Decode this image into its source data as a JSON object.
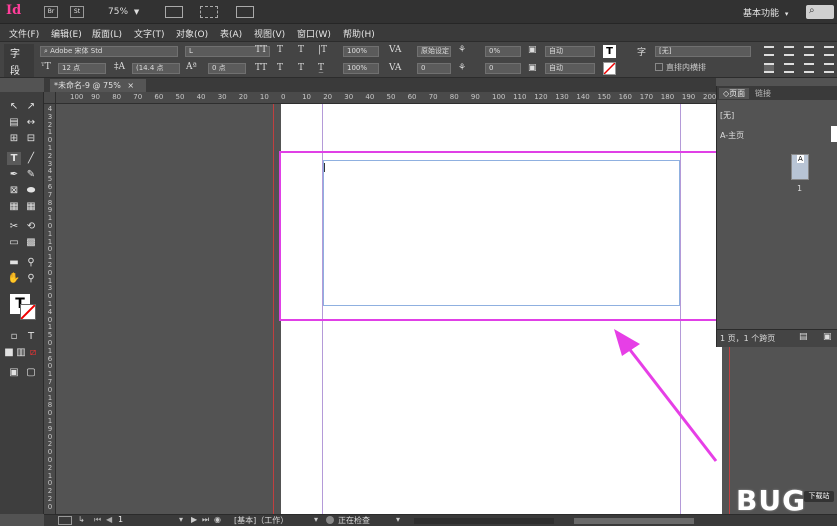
{
  "app": {
    "logo": "Id",
    "bridge_label": "Br",
    "stock_label": "St",
    "zoom": "75%",
    "workspace": "基本功能",
    "search_icon": "search-icon"
  },
  "menu": [
    "文件(F)",
    "编辑(E)",
    "版面(L)",
    "文字(T)",
    "对象(O)",
    "表(A)",
    "视图(V)",
    "窗口(W)",
    "帮助(H)"
  ],
  "control": {
    "char_mode_label": "字",
    "para_mode_label": "段",
    "font_family": "Adobe 宋体 Std",
    "font_style": "L",
    "font_size": "12 点",
    "leading": "(14.4 点",
    "baseline_shift": "0 点",
    "scale_h": "100%",
    "scale_v": "100%",
    "kerning": "原始设定",
    "tracking": "0",
    "tsume": "0%",
    "aki": "0",
    "auto1": "自动",
    "auto2": "自动",
    "char_style": "[无]",
    "tate_chu_yoko": "直排内横排",
    "tt_label": "TT",
    "t_super": "T",
    "t_label": "T"
  },
  "document": {
    "tab_title": "*未命名-9 @ 75%"
  },
  "ruler": {
    "h_ticks": [
      "100",
      "90",
      "80",
      "70",
      "60",
      "50",
      "40",
      "30",
      "20",
      "10",
      "0",
      "10",
      "20",
      "30",
      "40",
      "50",
      "60",
      "70",
      "80",
      "90",
      "100",
      "110",
      "120",
      "130",
      "140",
      "150",
      "160",
      "170",
      "180",
      "190",
      "200"
    ],
    "v_ticks": [
      "4",
      "3",
      "2",
      "1",
      "0",
      "1",
      "2",
      "3",
      "4",
      "5",
      "6",
      "7",
      "8",
      "9",
      "1",
      "0",
      "1",
      "1",
      "0",
      "1",
      "2",
      "0",
      "1",
      "3",
      "0",
      "1",
      "4",
      "0",
      "1",
      "5",
      "0",
      "1",
      "6",
      "0",
      "1",
      "7",
      "0",
      "1",
      "8",
      "0",
      "1",
      "9",
      "0",
      "2",
      "0",
      "0",
      "2",
      "1",
      "0",
      "2",
      "2",
      "0"
    ]
  },
  "status": {
    "page_number": "1",
    "master": "[基本]（工作）",
    "preflight": "正在检查"
  },
  "pages_panel": {
    "tab_pages": "页面",
    "tab_links": "链接",
    "none_label": "[无]",
    "master_label": "A-主页",
    "page_thumb_letter": "A",
    "page_thumb_number": "1",
    "footer": "1 页，1 个跨页"
  },
  "watermark": {
    "text": "BUG",
    "small": "下载站"
  },
  "colors": {
    "highlight": "#e040e6",
    "arrow": "#e63fe6",
    "frame": "#8fb0e0",
    "logo": "#ff3e9a"
  }
}
